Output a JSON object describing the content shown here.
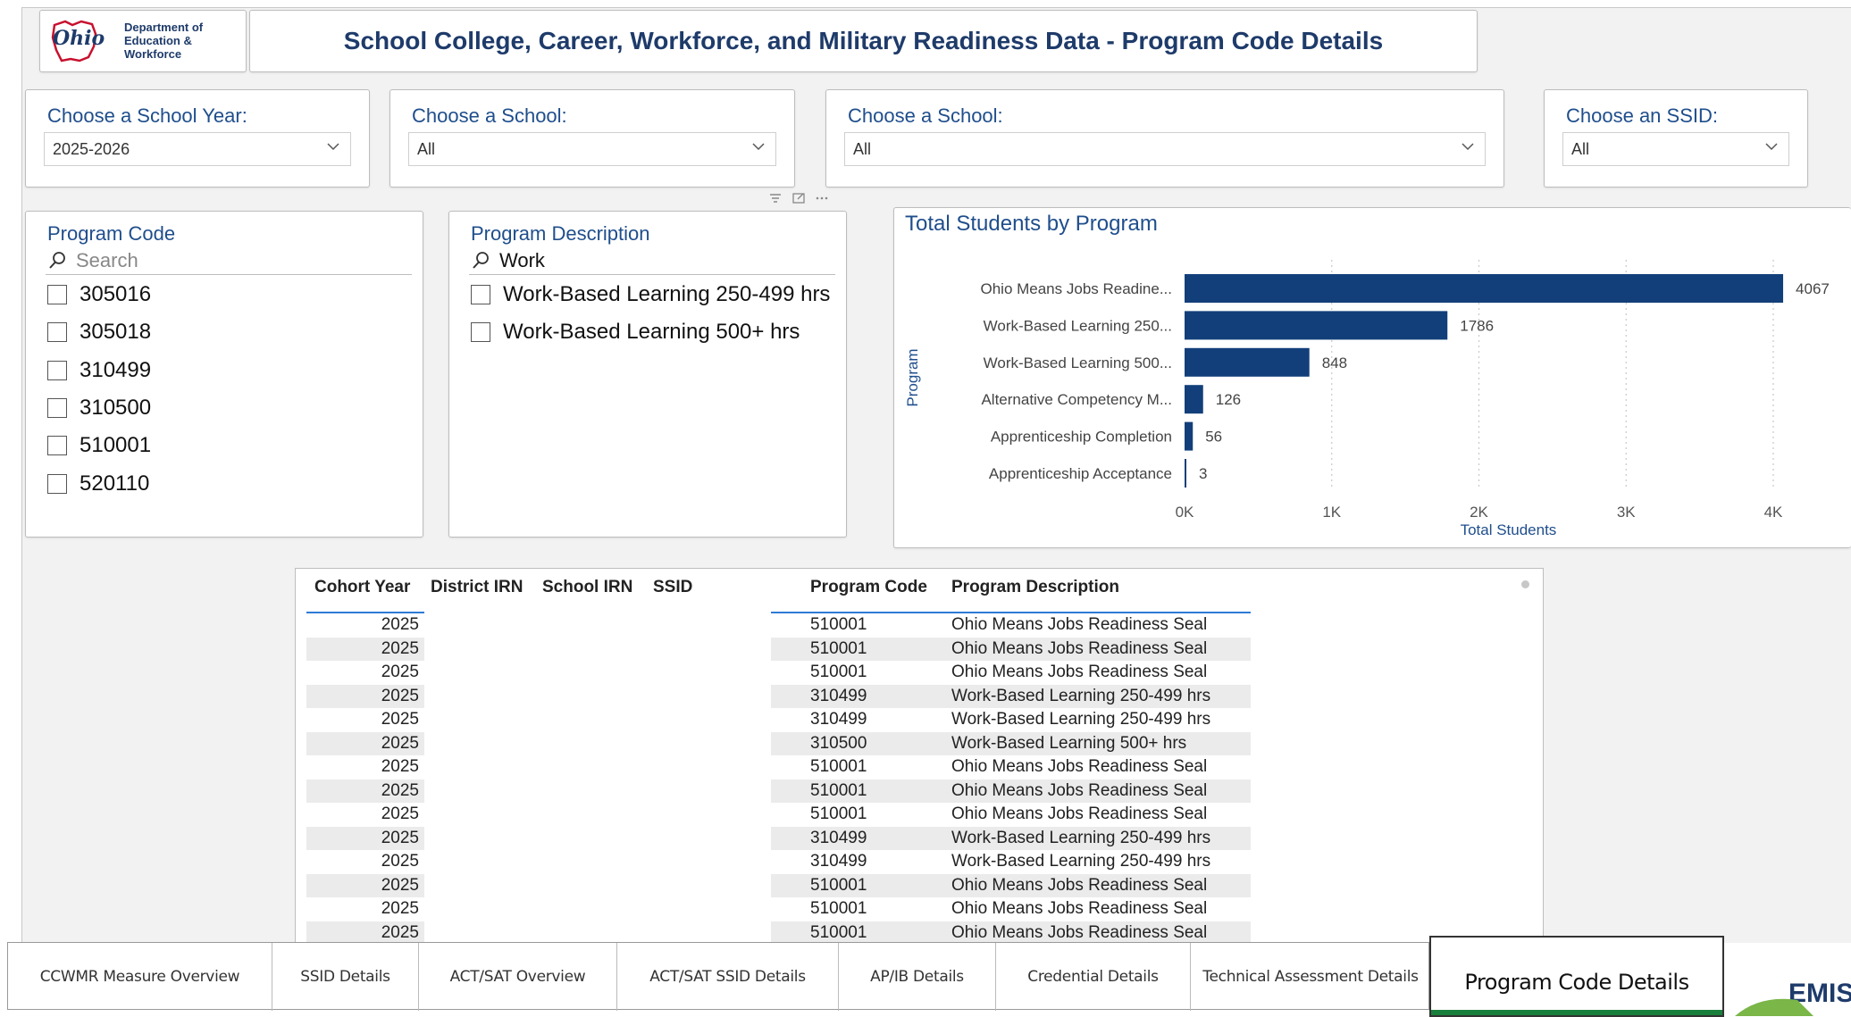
{
  "header": {
    "logo_line1": "Department of",
    "logo_line2": "Education &",
    "logo_line3": "Workforce",
    "logo_script": "Ohio",
    "title": "School College, Career, Workforce, and Military Readiness Data - Program Code Details"
  },
  "filters": [
    {
      "label": "Choose a School Year:",
      "value": "2025-2026"
    },
    {
      "label": "Choose a School:",
      "value": "All"
    },
    {
      "label": "Choose a School:",
      "value": "All"
    },
    {
      "label": "Choose an SSID:",
      "value": "All"
    }
  ],
  "program_code_slicer": {
    "title": "Program Code",
    "search_placeholder": "Search",
    "items": [
      "305016",
      "305018",
      "310499",
      "310500",
      "510001",
      "520110"
    ]
  },
  "program_desc_slicer": {
    "title": "Program Description",
    "search_value": "Work",
    "items": [
      "Work-Based Learning 250-499 hrs",
      "Work-Based Learning 500+ hrs"
    ]
  },
  "chart_data": {
    "type": "bar",
    "orientation": "horizontal",
    "title": "Total Students by Program",
    "ylabel": "Program",
    "xlabel": "Total Students",
    "categories": [
      "Ohio Means Jobs Readine...",
      "Work-Based Learning 250...",
      "Work-Based Learning 500...",
      "Alternative Competency M...",
      "Apprenticeship Completion",
      "Apprenticeship Acceptance"
    ],
    "values": [
      4067,
      1786,
      848,
      126,
      56,
      3
    ],
    "xticks": [
      "0K",
      "1K",
      "2K",
      "3K",
      "4K"
    ],
    "xlim": [
      0,
      4000
    ],
    "bar_color": "#123f7a",
    "grid": "dotted vertical"
  },
  "table": {
    "columns": [
      "Cohort Year",
      "District IRN",
      "School IRN",
      "SSID",
      "Program Code",
      "Program Description"
    ],
    "rows": [
      [
        "2025",
        "510001",
        "Ohio Means Jobs Readiness Seal"
      ],
      [
        "2025",
        "510001",
        "Ohio Means Jobs Readiness Seal"
      ],
      [
        "2025",
        "510001",
        "Ohio Means Jobs Readiness Seal"
      ],
      [
        "2025",
        "310499",
        "Work-Based Learning 250-499 hrs"
      ],
      [
        "2025",
        "310499",
        "Work-Based Learning 250-499 hrs"
      ],
      [
        "2025",
        "310500",
        "Work-Based Learning 500+ hrs"
      ],
      [
        "2025",
        "510001",
        "Ohio Means Jobs Readiness Seal"
      ],
      [
        "2025",
        "510001",
        "Ohio Means Jobs Readiness Seal"
      ],
      [
        "2025",
        "510001",
        "Ohio Means Jobs Readiness Seal"
      ],
      [
        "2025",
        "310499",
        "Work-Based Learning 250-499 hrs"
      ],
      [
        "2025",
        "310499",
        "Work-Based Learning 250-499 hrs"
      ],
      [
        "2025",
        "510001",
        "Ohio Means Jobs Readiness Seal"
      ],
      [
        "2025",
        "510001",
        "Ohio Means Jobs Readiness Seal"
      ],
      [
        "2025",
        "510001",
        "Ohio Means Jobs Readiness Seal"
      ]
    ]
  },
  "tabs": [
    "CCWMR Measure Overview",
    "SSID Details",
    "ACT/SAT Overview",
    "ACT/SAT SSID Details",
    "AP/IB Details",
    "Credential Details",
    "Technical Assessment Details"
  ],
  "active_tab": "Program Code Details",
  "emis_logo": "EMIS",
  "colors": {
    "accent_blue": "#1f4e8c",
    "bar": "#123f7a",
    "title": "#1e3b6a",
    "tab_active_bar": "#1a7f3c",
    "emis_green": "#7ab648"
  }
}
